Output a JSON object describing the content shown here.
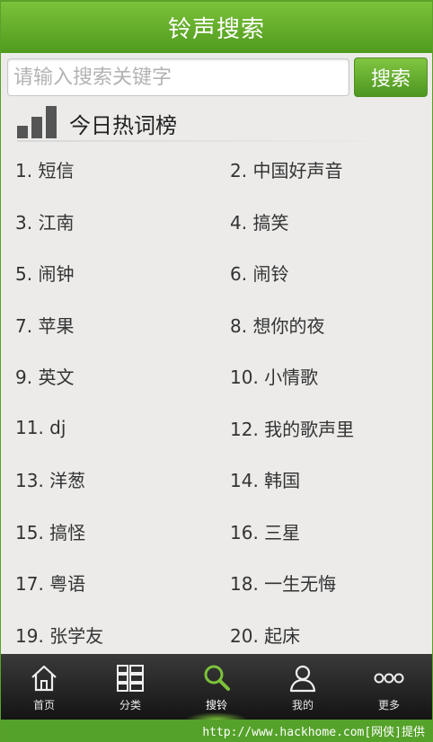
{
  "header": {
    "title": "铃声搜索"
  },
  "search": {
    "placeholder": "请输入搜索关键字",
    "value": "",
    "button_label": "搜索"
  },
  "hot": {
    "icon": "bar-chart-icon",
    "title": "今日热词榜",
    "items": [
      "1. 短信",
      "2. 中国好声音",
      "3. 江南",
      "4. 搞笑",
      "5. 闹钟",
      "6. 闹铃",
      "7. 苹果",
      "8. 想你的夜",
      "9. 英文",
      "10. 小情歌",
      "11. dj",
      "12. 我的歌声里",
      "13. 洋葱",
      "14. 韩国",
      "15. 搞怪",
      "16. 三星",
      "17. 粤语",
      "18. 一生无悔",
      "19. 张学友",
      "20. 起床"
    ]
  },
  "nav": {
    "items": [
      {
        "label": "首页",
        "icon": "home-icon",
        "active": false
      },
      {
        "label": "分类",
        "icon": "grid-list-icon",
        "active": false
      },
      {
        "label": "搜铃",
        "icon": "search-icon",
        "active": true
      },
      {
        "label": "我的",
        "icon": "user-icon",
        "active": false
      },
      {
        "label": "更多",
        "icon": "more-icon",
        "active": false
      }
    ]
  },
  "footer": {
    "text": "http://www.hackhome.com[网侠]提供"
  },
  "colors": {
    "brand_green": "#5aa12a",
    "active_green": "#7cc23a",
    "nav_dark": "#1e1e1e"
  }
}
